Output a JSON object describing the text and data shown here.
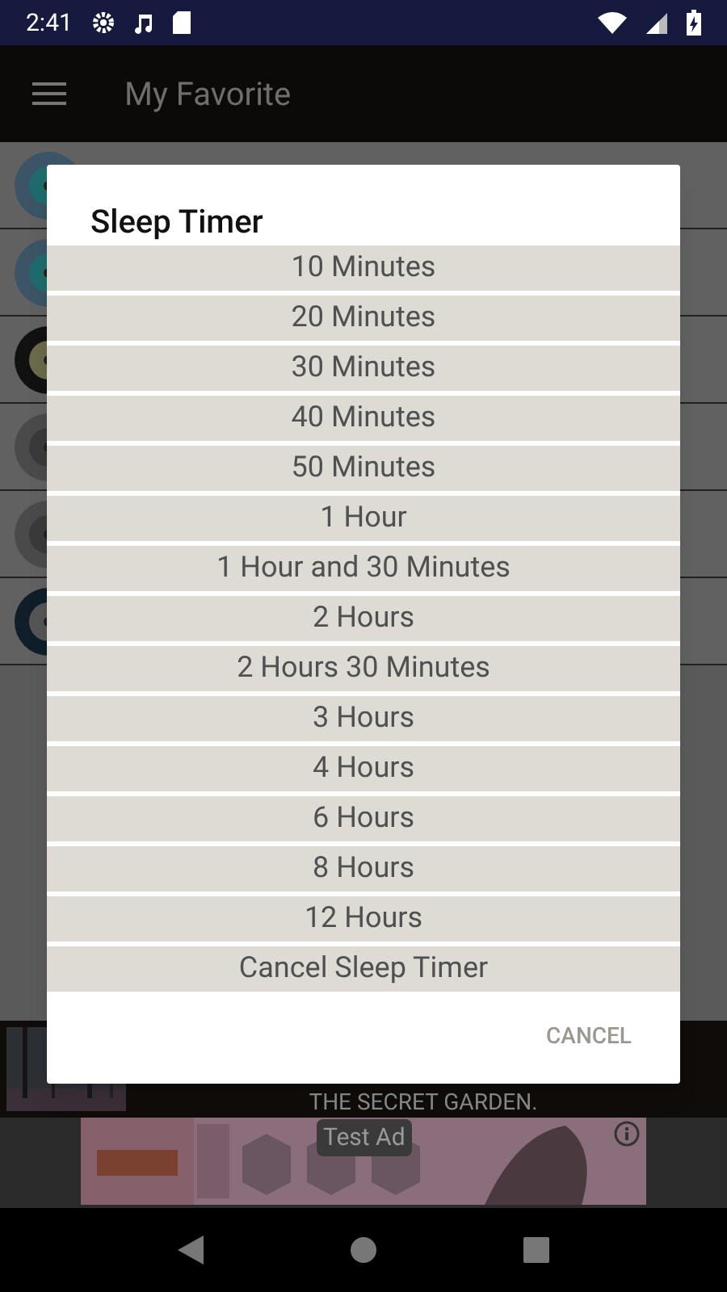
{
  "status_bar": {
    "time": "2:41"
  },
  "app_bar": {
    "title": "My Favorite"
  },
  "song_rows": [
    {
      "kind": "disc"
    },
    {
      "kind": "disc"
    },
    {
      "kind": "vinyl"
    },
    {
      "kind": "gray"
    },
    {
      "kind": "gray"
    },
    {
      "kind": "ring"
    }
  ],
  "player": {
    "song": "THE SECRET GARDEN."
  },
  "ad": {
    "label": "Test Ad"
  },
  "dialog": {
    "title": "Sleep Timer",
    "options": [
      "10 Minutes",
      "20 Minutes",
      "30 Minutes",
      "40 Minutes",
      "50 Minutes",
      "1 Hour",
      "1 Hour and 30 Minutes",
      "2 Hours",
      "2 Hours 30 Minutes",
      "3 Hours",
      "4 Hours",
      "6 Hours",
      "8 Hours",
      "12 Hours",
      "Cancel Sleep Timer"
    ],
    "button": "CANCEL"
  }
}
